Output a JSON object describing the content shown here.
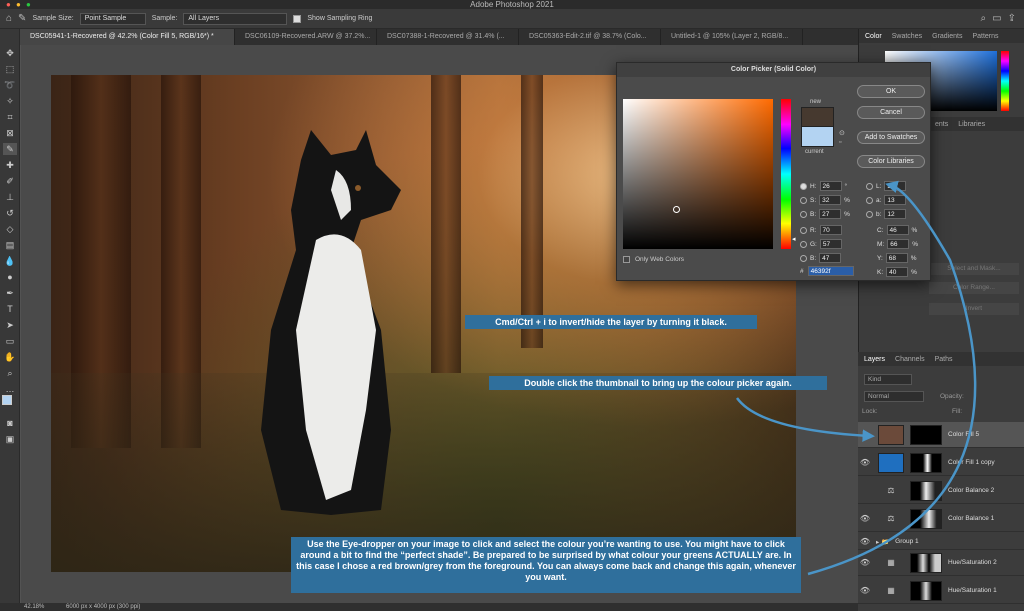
{
  "app": {
    "title": "Adobe Photoshop 2021"
  },
  "options_bar": {
    "sample_size_label": "Sample Size:",
    "sample_size_value": "Point Sample",
    "sample_label": "Sample:",
    "sample_value": "All Layers",
    "show_ring_label": "Show Sampling Ring"
  },
  "tabs": [
    {
      "label": "DSC05941-1-Recovered @ 42.2% (Color Fill 5, RGB/16*) *"
    },
    {
      "label": "DSC06109-Recovered.ARW @ 37.2%..."
    },
    {
      "label": "DSC07388-1-Recovered @ 31.4% (..."
    },
    {
      "label": "DSC05363-Edit-2.tif @ 38.7% (Colo..."
    },
    {
      "label": "Untitled-1 @ 105% (Layer 2, RGB/8..."
    }
  ],
  "right_panel": {
    "top_tabs": [
      "Color",
      "Swatches",
      "Gradients",
      "Patterns"
    ],
    "mid_tabs": [
      "ents",
      "Libraries"
    ],
    "layers_tabs": [
      "Layers",
      "Channels",
      "Paths"
    ],
    "kind_label": "Kind",
    "blend_mode": "Normal",
    "opacity_label": "Opacity:",
    "lock_label": "Lock:",
    "fill_label": "Fill:",
    "faded_buttons": [
      "Select and Mask...",
      "Color Range...",
      "Invert"
    ]
  },
  "color_picker": {
    "title": "Color Picker (Solid Color)",
    "new_label": "new",
    "current_label": "current",
    "new_color": "#46392f",
    "current_color": "#b3d3f2",
    "buttons": {
      "ok": "OK",
      "cancel": "Cancel",
      "add_swatches": "Add to Swatches",
      "color_libraries": "Color Libraries"
    },
    "only_web_colors": "Only Web Colors",
    "hsb": {
      "h_label": "H:",
      "h": "26",
      "h_unit": "°",
      "s_label": "S:",
      "s": "32",
      "s_unit": "%",
      "b_label": "B:",
      "b": "27",
      "b_unit": "%"
    },
    "rgb": {
      "r_label": "R:",
      "r": "70",
      "g_label": "G:",
      "g": "57",
      "b_label": "B:",
      "b": "47"
    },
    "lab": {
      "l_label": "L:",
      "l": "33",
      "a_label": "a:",
      "a": "13",
      "b_label": "b:",
      "b": "12"
    },
    "cmyk": {
      "c_label": "C:",
      "c": "46",
      "m_label": "M:",
      "m": "66",
      "y_label": "Y:",
      "y": "68",
      "k_label": "K:",
      "k": "40",
      "unit": "%"
    },
    "hex_label": "#",
    "hex": "46392f"
  },
  "layers": [
    {
      "name": "Color Fill 5",
      "thumb": "#6b4a3a",
      "selected": true
    },
    {
      "name": "Color Fill 1 copy",
      "thumb": "#1f6fbf",
      "selected": false
    },
    {
      "name": "Color Balance 2",
      "thumb": "",
      "selected": false
    },
    {
      "name": "Color Balance 1",
      "thumb": "",
      "selected": false
    },
    {
      "name": "Group 1",
      "thumb": "",
      "selected": false
    },
    {
      "name": "Hue/Saturation 2",
      "thumb": "",
      "selected": false
    },
    {
      "name": "Hue/Saturation 1",
      "thumb": "",
      "selected": false
    }
  ],
  "annotations": {
    "note1": "Cmd/Ctrl + i to invert/hide the layer by turning it black.",
    "note2": "Double click the thumbnail to bring up the colour picker again.",
    "note3": "Use the Eye-dropper on your image to click and select the colour you’re wanting to use. You might have to click around a bit to find the “perfect shade”. Be prepared to be surprised by what colour your greens ACTUALLY are. In this case I chose a red brown/grey from the foreground. You can always come back and change this again, whenever you want."
  },
  "status_bar": {
    "zoom": "42.18%",
    "doc_info": "6000 px x 4000 px (300 ppi)"
  },
  "colors": {
    "annotation": "#2f6f9c",
    "arrow": "#4a95c8"
  }
}
